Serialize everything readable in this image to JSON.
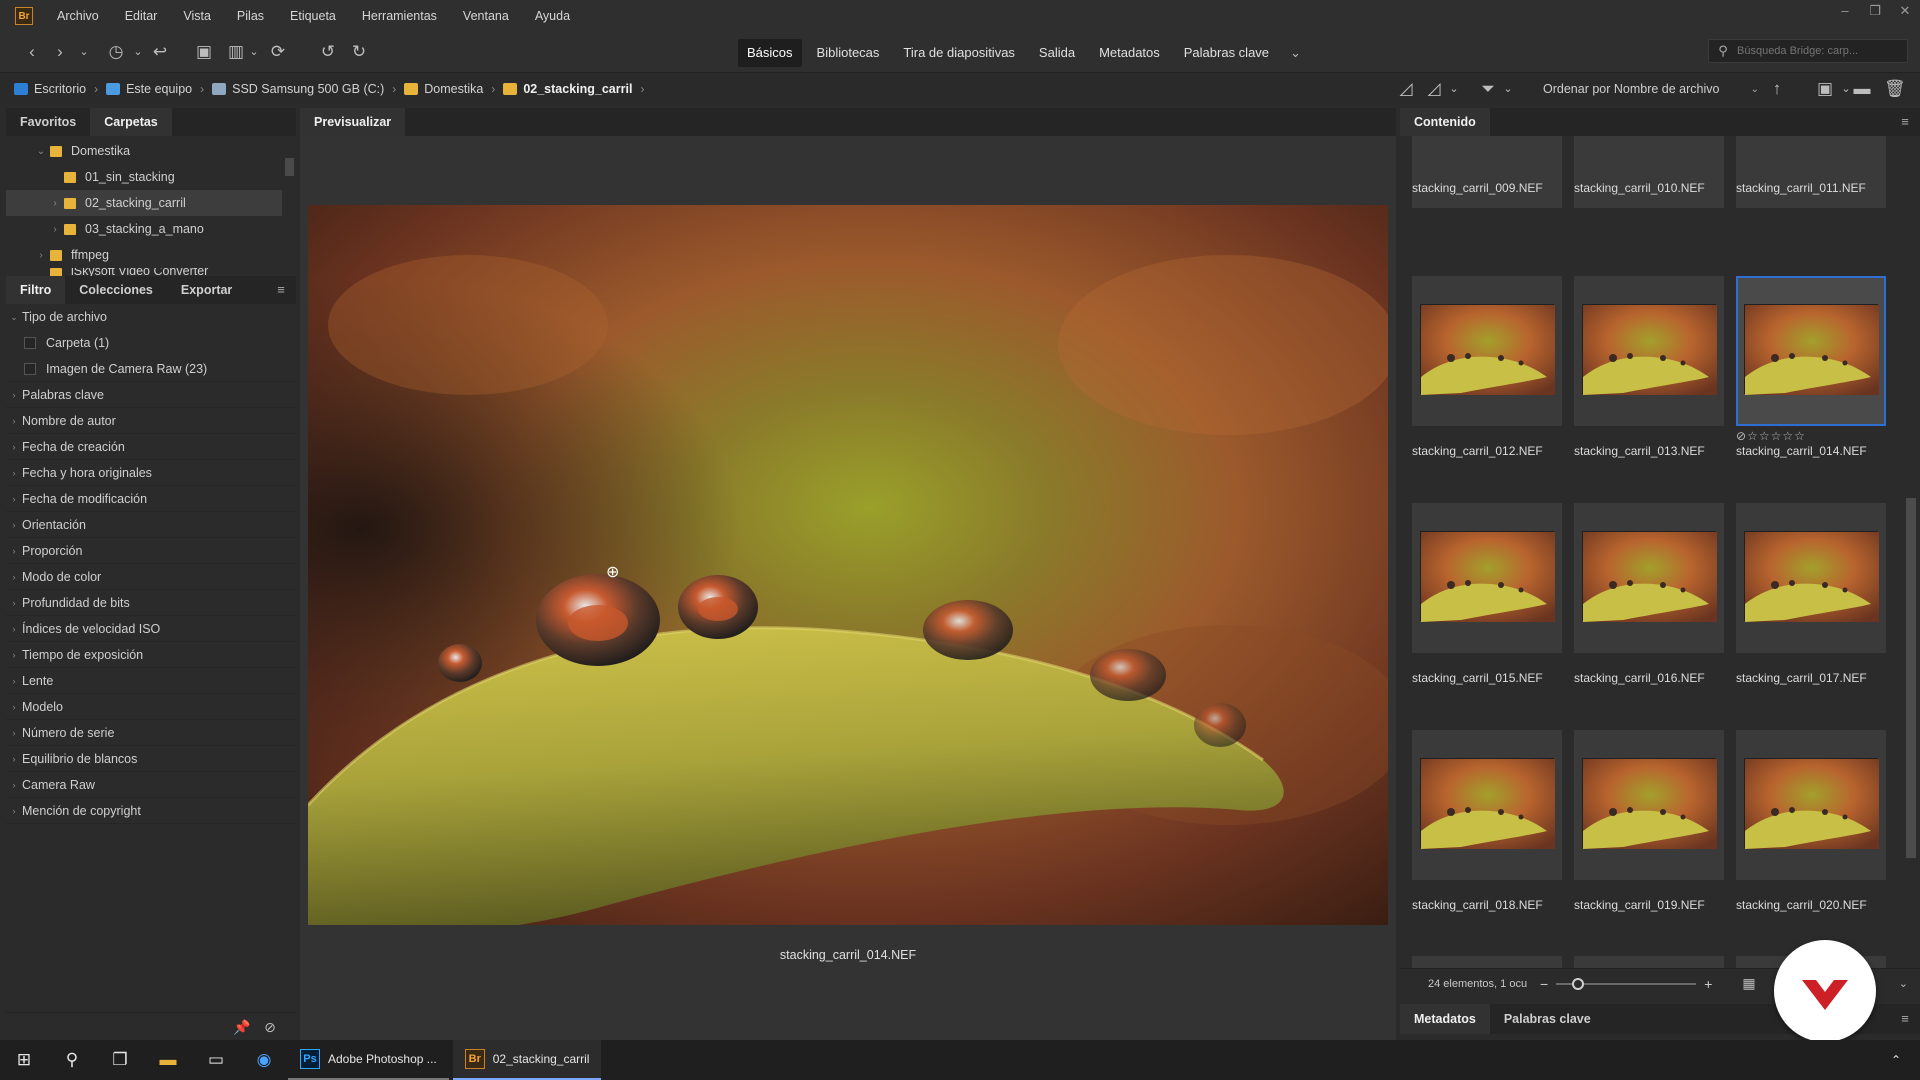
{
  "menubar": {
    "app_badge": "Br",
    "items": [
      "Archivo",
      "Editar",
      "Vista",
      "Pilas",
      "Etiqueta",
      "Herramientas",
      "Ventana",
      "Ayuda"
    ]
  },
  "toolbar": {
    "workspaces": [
      "Básicos",
      "Bibliotecas",
      "Tira de diapositivas",
      "Salida",
      "Metadatos",
      "Palabras clave"
    ],
    "active_workspace": "Básicos",
    "search_placeholder": "Búsqueda Bridge: carp..."
  },
  "pathbar": {
    "crumbs": [
      "Escritorio",
      "Este equipo",
      "SSD Samsung 500 GB (C:)",
      "Domestika",
      "02_stacking_carril"
    ],
    "sort_label": "Ordenar por Nombre de archivo"
  },
  "left": {
    "top_tabs": [
      "Favoritos",
      "Carpetas"
    ],
    "active_top_tab": "Carpetas",
    "tree": [
      {
        "label": "Domestika",
        "level": 1,
        "expanded": true
      },
      {
        "label": "01_sin_stacking",
        "level": 2
      },
      {
        "label": "02_stacking_carril",
        "level": 2,
        "selected": true
      },
      {
        "label": "03_stacking_a_mano",
        "level": 2
      },
      {
        "label": "ffmpeg",
        "level": 1
      },
      {
        "label": "iSkysoft Video Converter",
        "level": 1
      }
    ],
    "filter_tabs": [
      "Filtro",
      "Colecciones",
      "Exportar"
    ],
    "active_filter_tab": "Filtro",
    "file_type_header": "Tipo de archivo",
    "file_type_items": [
      "Carpeta (1)",
      "Imagen de Camera Raw (23)"
    ],
    "filter_groups": [
      "Palabras clave",
      "Nombre de autor",
      "Fecha de creación",
      "Fecha y hora originales",
      "Fecha de modificación",
      "Orientación",
      "Proporción",
      "Modo de color",
      "Profundidad de bits",
      "Índices de velocidad ISO",
      "Tiempo de exposición",
      "Lente",
      "Modelo",
      "Número de serie",
      "Equilibrio de blancos",
      "Camera Raw",
      "Mención de copyright"
    ]
  },
  "preview": {
    "tab": "Previsualizar",
    "caption": "stacking_carril_014.NEF"
  },
  "content": {
    "tab": "Contenido",
    "files": [
      "stacking_carril_009.NEF",
      "stacking_carril_010.NEF",
      "stacking_carril_011.NEF",
      "stacking_carril_012.NEF",
      "stacking_carril_013.NEF",
      "stacking_carril_014.NEF",
      "stacking_carril_015.NEF",
      "stacking_carril_016.NEF",
      "stacking_carril_017.NEF",
      "stacking_carril_018.NEF",
      "stacking_carril_019.NEF",
      "stacking_carril_020.NEF"
    ],
    "selected_file": "stacking_carril_014.NEF",
    "rating_stars": "☆☆☆☆☆",
    "status": "24 elementos, 1 ocu",
    "bottom_tabs": [
      "Metadatos",
      "Palabras clave"
    ]
  },
  "taskbar": {
    "apps": [
      {
        "badge": "Ps",
        "label": "Adobe Photoshop ..."
      },
      {
        "badge": "Br",
        "label": "02_stacking_carril"
      }
    ]
  },
  "colors": {
    "accent_selection": "#2e6fd1",
    "folder_yellow": "#e8b33a",
    "bridge_orange": "#f4a23a",
    "photoshop_blue": "#31a8ff",
    "brand_red": "#cc1f26"
  }
}
